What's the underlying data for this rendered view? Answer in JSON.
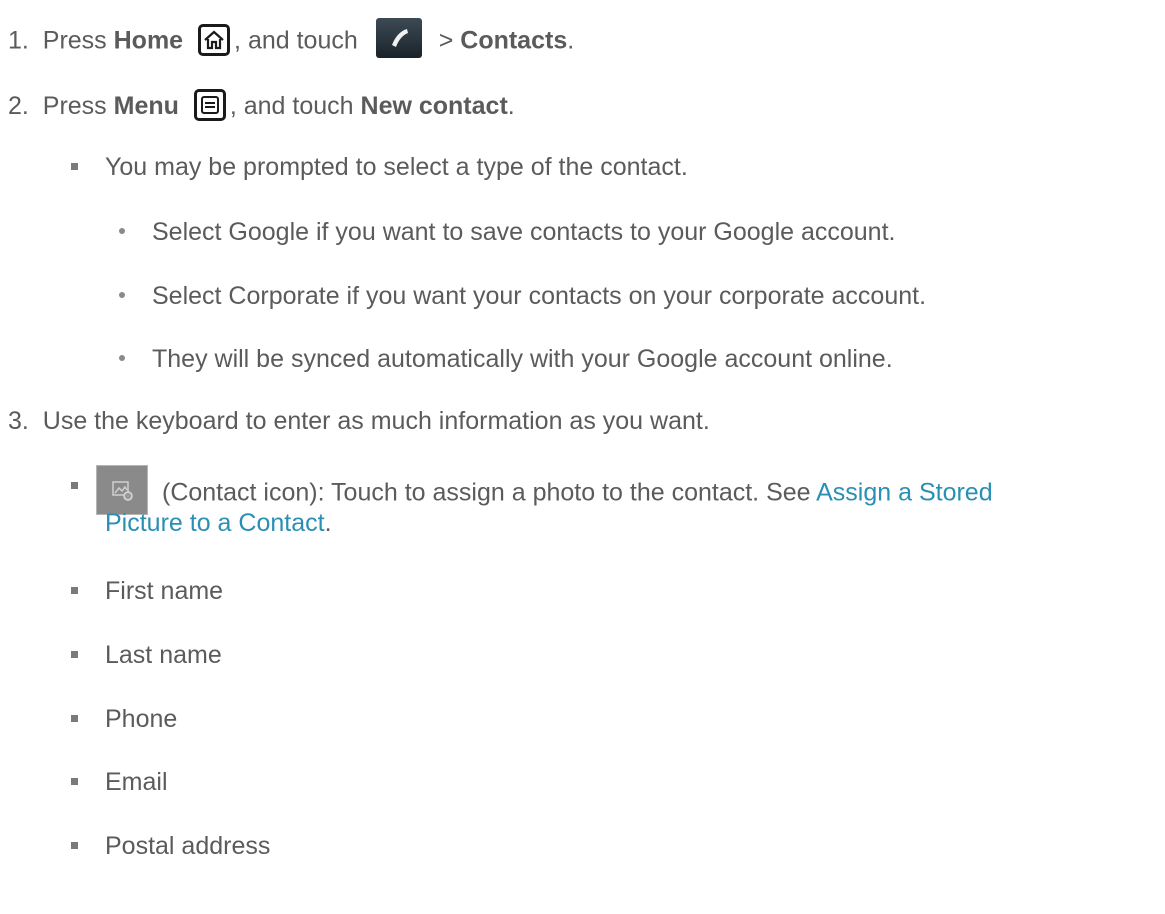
{
  "steps": [
    {
      "number": "1.",
      "text_1": "Press ",
      "bold_1": "Home",
      "text_2": ", and touch",
      "text_3": " > ",
      "bold_2": "Contacts",
      "text_4": "."
    },
    {
      "number": "2.",
      "text_1": "Press ",
      "bold_1": "Menu",
      "text_2": ", and touch ",
      "bold_2": "New contact",
      "text_3": "."
    },
    {
      "number": "3.",
      "text": "Use the keyboard to enter as much information as you want."
    }
  ],
  "step2_note": "You may be prompted to select a type of the contact.",
  "step2_subitems": [
    "Select Google if you want to save contacts to your Google account.",
    "Select Corporate if you want your contacts on your corporate account.",
    "They will be synced automatically with your Google account online."
  ],
  "contact_icon_item": {
    "text": "(Contact icon): Touch to assign a photo to the contact. See ",
    "link_line1": "Assign a Stored",
    "link_line2": "Picture to a Contact",
    "after": "."
  },
  "fields": [
    "First name",
    "Last name",
    "Phone",
    "Email",
    "Postal address"
  ],
  "icons": {
    "home": "home-icon",
    "phone": "phone-icon",
    "menu": "menu-icon",
    "contact_photo": "contact-photo-icon"
  },
  "colors": {
    "text": "#5b5b5b",
    "link": "#2a8fb4"
  }
}
